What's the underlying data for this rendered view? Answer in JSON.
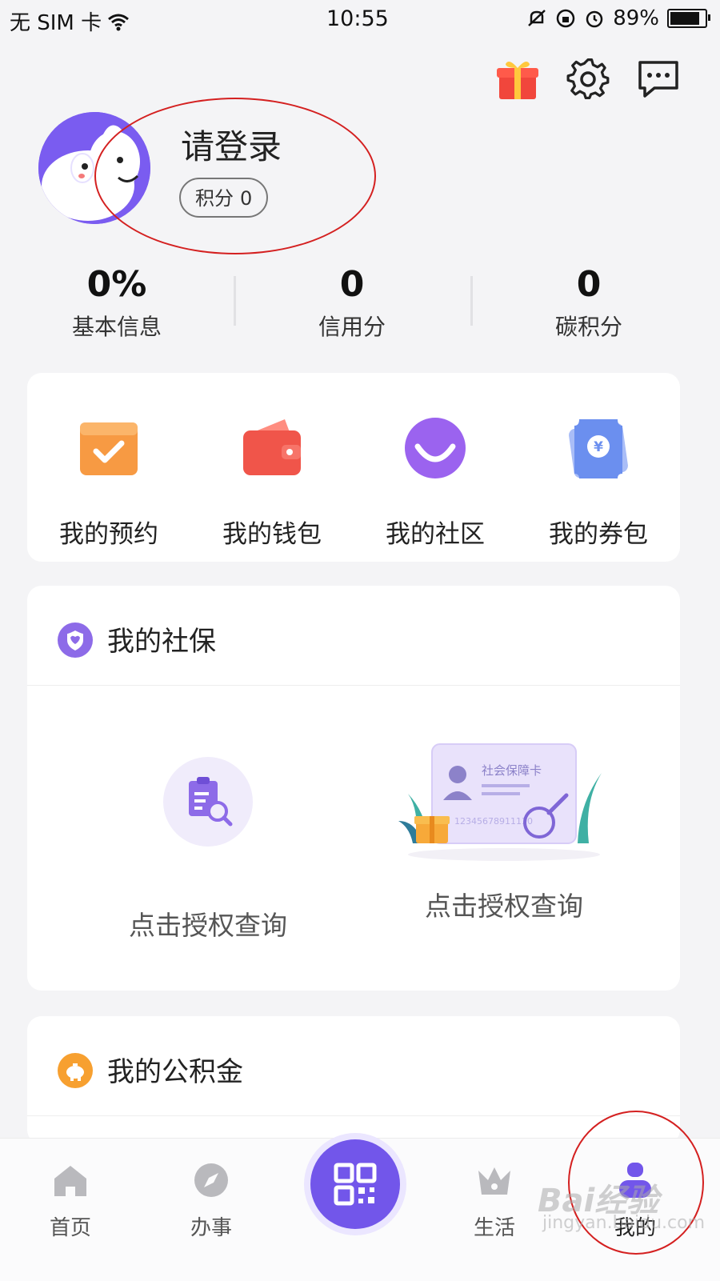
{
  "status_bar": {
    "carrier": "无 SIM 卡",
    "time": "10:55",
    "battery": "89%",
    "battery_level": 0.89
  },
  "header": {
    "icons": [
      "gift-icon",
      "gear-icon",
      "message-icon"
    ]
  },
  "profile": {
    "login_prompt": "请登录",
    "points_label": "积分",
    "points_value": "0"
  },
  "stats": [
    {
      "value": "0%",
      "label": "基本信息"
    },
    {
      "value": "0",
      "label": "信用分"
    },
    {
      "value": "0",
      "label": "碳积分"
    }
  ],
  "quick_actions": [
    {
      "label": "我的预约",
      "icon": "calendar-check-icon",
      "color": "#f79a43"
    },
    {
      "label": "我的钱包",
      "icon": "wallet-icon",
      "color": "#f0554a"
    },
    {
      "label": "我的社区",
      "icon": "smile-icon",
      "color": "#9b63ef"
    },
    {
      "label": "我的券包",
      "icon": "coupon-icon",
      "color": "#6b8fef"
    }
  ],
  "social_insurance": {
    "title": "我的社保",
    "card_text": "社会保障卡",
    "card_number": "12345678911110",
    "items": [
      {
        "label": "点击授权查询"
      },
      {
        "label": "点击授权查询"
      }
    ]
  },
  "housing_fund": {
    "title": "我的公积金"
  },
  "tabbar": {
    "tabs": [
      {
        "label": "首页",
        "icon": "home-icon"
      },
      {
        "label": "办事",
        "icon": "compass-icon"
      },
      {
        "label": "生活",
        "icon": "crown-icon"
      },
      {
        "label": "我的",
        "icon": "user-icon"
      }
    ],
    "center_icon": "qr-code-icon"
  },
  "watermark": {
    "brand": "Bai经验",
    "url": "jingyan.baidu.com"
  },
  "colors": {
    "accent": "#7256ea",
    "annotation_red": "#d42020",
    "background": "#f4f4f6"
  }
}
